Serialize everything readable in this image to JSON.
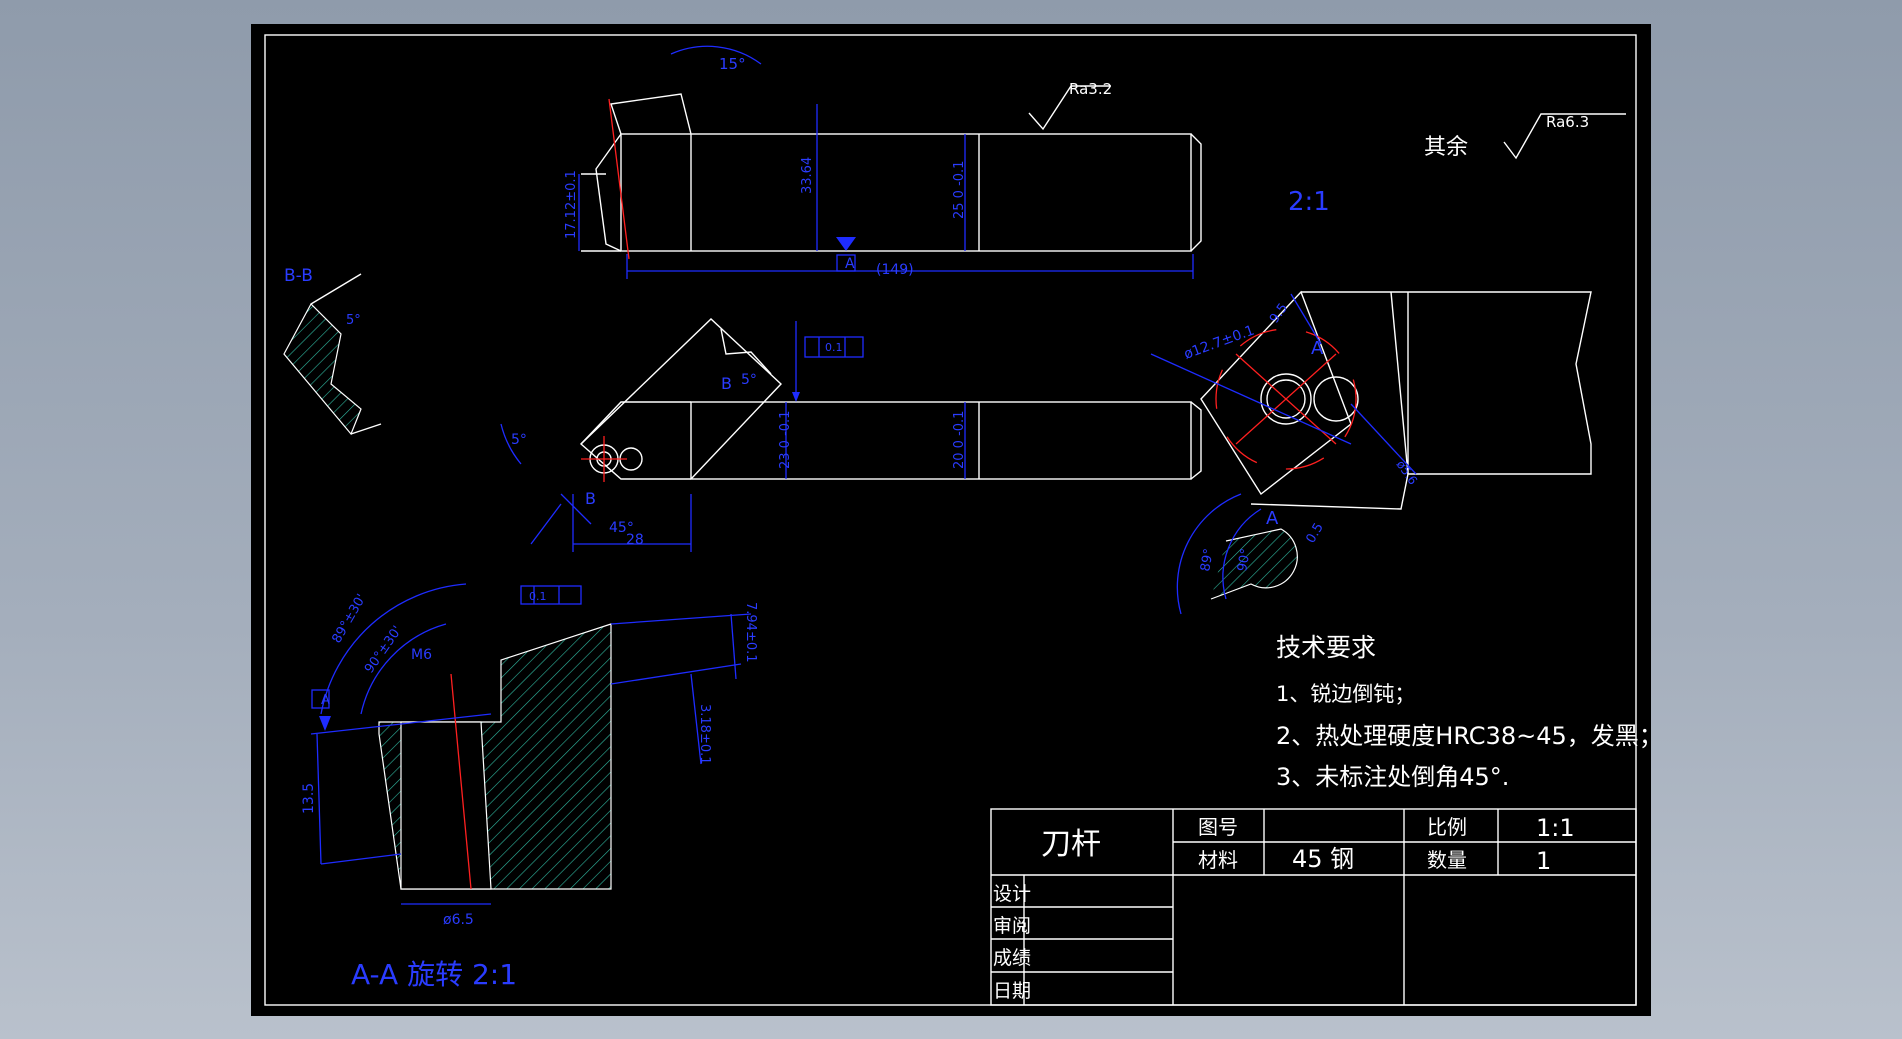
{
  "drawing": {
    "title": "刀杆",
    "drawing_no_label": "图号",
    "drawing_no": "",
    "scale_label": "比例",
    "scale": "1:1",
    "material_label": "材料",
    "material": "45 钢",
    "quantity_label": "数量",
    "quantity": "1",
    "sign_rows": [
      "设计",
      "审阅",
      "成绩",
      "日期"
    ]
  },
  "notes": {
    "heading": "技术要求",
    "items": [
      "1、锐边倒钝；",
      "2、热处理硬度HRC38~45，发黑；",
      "3、未标注处倒角45°."
    ]
  },
  "surface": {
    "rest_label": "其余",
    "rest_value": "Ra6.3",
    "main_value": "Ra3.2"
  },
  "views": {
    "detail_scale": "2:1",
    "section_aa_label": "A-A 旋转  2:1",
    "section_bb_label": "B-B",
    "datum_label": "A"
  },
  "dimensions": {
    "top_angle": "15°",
    "overall_length": "(149)",
    "head_height": "17.12±0.1",
    "body_height": "33.64",
    "shank_height": "25 0 -0.1",
    "shank_width": "20 0 -0.1",
    "head_width": "23 0 -0.1",
    "length_28": "28",
    "angle_45": "45°",
    "angle_5a": "5°",
    "angle_5b": "5°",
    "angle_5c": "5°",
    "seat_hole": "ø12.7±0.1",
    "seat_dim": "9.5",
    "relief_dia": "ø5.6",
    "detail_89": "89°",
    "detail_90": "90°",
    "detail_05": "0.5",
    "m6": "M6",
    "angle_89": "89°±30'",
    "angle_90": "90°±30'",
    "dim_794": "7.94±0.1",
    "dim_318": "3.18±0.1",
    "dim_135": "13.5",
    "dim_d65": "ø6.5",
    "tol_flat": "0.1",
    "tol_para": "0.1",
    "section_b": "B",
    "section_a": "A"
  }
}
